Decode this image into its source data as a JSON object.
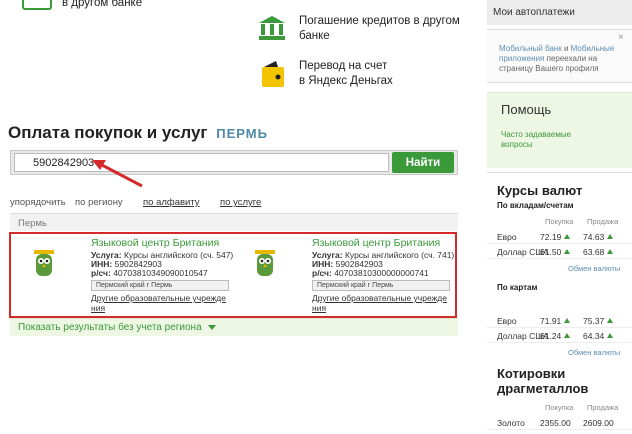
{
  "transfers": {
    "other_bank_partial": "в другом банке",
    "loan_repayment": "Погашение кредитов в другом банке",
    "loan_repayment_l1": "Погашение кредитов в другом",
    "loan_repayment_l2": "банке",
    "yandex_l1": "Перевод на счет",
    "yandex_l2": "в Яндекс Деньгах"
  },
  "main": {
    "title": "Оплата покупок и услуг",
    "region": "ПЕРМЬ",
    "search_value": "5902842903",
    "find_button": "Найти"
  },
  "sort": {
    "label": "упорядочить",
    "by_region": "по региону",
    "by_alphabet": "по алфавиту",
    "by_service": "по услуге"
  },
  "results": {
    "group": "Пермь",
    "cards": [
      {
        "name": "Языковой центр Британия",
        "service_label": "Услуга:",
        "service": "Курсы английского (сч. 547)",
        "inn_label": "ИНН:",
        "inn": "5902842903",
        "account_label": "р/сч:",
        "account": "40703810349090010547",
        "region": "Пермский край г Пермь",
        "category_l1": "Другие образовательные учрежде",
        "category_l2": "ния"
      },
      {
        "name": "Языковой центр Британия",
        "service_label": "Услуга:",
        "service": "Курсы английского (сч. 741)",
        "inn_label": "ИНН:",
        "inn": "5902842903",
        "account_label": "р/сч:",
        "account": "40703810300000000741",
        "region": "Пермский край г Пермь",
        "category_l1": "Другие образовательные учрежде",
        "category_l2": "ния"
      }
    ],
    "show_all": "Показать результаты без учета региона"
  },
  "sidebar": {
    "autopay": "Мои автоплатежи",
    "mobile_p1": "Мобильный банк",
    "mobile_and": " и ",
    "mobile_p2": "Мобильные приложения",
    "mobile_p3": " переехали на страницу Вашего профиля",
    "help_title": "Помощь",
    "faq": "Часто задаваемые вопросы",
    "fx_title": "Курсы валют",
    "fx_deposits": "По вкладам/счетам",
    "fx_cards": "По картам",
    "col_buy": "Покупка",
    "col_sell": "Продажа",
    "fx_exchange_link": "Обмен валюты",
    "deposits_rates": [
      {
        "currency": "Евро",
        "buy": "72.19",
        "sell": "74.63"
      },
      {
        "currency": "Доллар США",
        "buy": "61.50",
        "sell": "63.68"
      }
    ],
    "card_rates": [
      {
        "currency": "Евро",
        "buy": "71.91",
        "sell": "75.37"
      },
      {
        "currency": "Доллар США",
        "buy": "61.24",
        "sell": "64.34"
      }
    ],
    "metals_title": "Котировки драгметаллов",
    "metals": [
      {
        "name": "Золото",
        "buy": "2355.00",
        "sell": "2609.00"
      }
    ]
  },
  "colors": {
    "accent_green": "#3a9a3a",
    "highlight_red": "#d42a2a",
    "link_blue": "#5e8fb0"
  }
}
